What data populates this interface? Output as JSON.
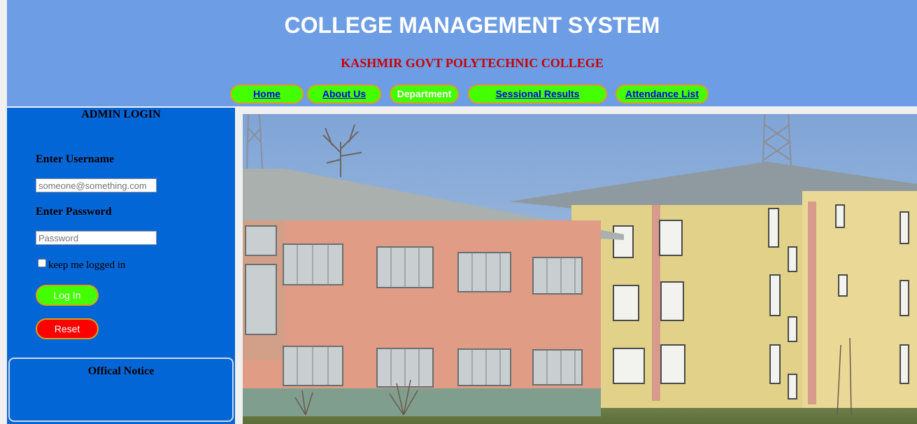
{
  "header": {
    "title": "COLLEGE MANAGEMENT SYSTEM",
    "subtitle": "KASHMIR GOVT POLYTECHNIC COLLEGE"
  },
  "nav": {
    "items": [
      {
        "label": "Home"
      },
      {
        "label": "About Us"
      },
      {
        "label": "Department"
      },
      {
        "label": "Sessional Results"
      },
      {
        "label": "Attendance List"
      }
    ]
  },
  "login": {
    "title": "ADMIN LOGIN",
    "username_label": "Enter Username",
    "username_placeholder": "someone@something.com",
    "password_label": "Enter Password",
    "password_placeholder": "Password",
    "remember_label": "keep me logged in",
    "login_button": "Log In",
    "reset_button": "Reset"
  },
  "notice": {
    "title": "Offical Notice"
  },
  "colors": {
    "header_bg": "#6d9de4",
    "subtitle": "#cc0000",
    "nav_button": "#44ff00",
    "nav_border": "#e0a010",
    "sidebar_bg": "#0366d6",
    "reset_button": "#ff0000"
  }
}
